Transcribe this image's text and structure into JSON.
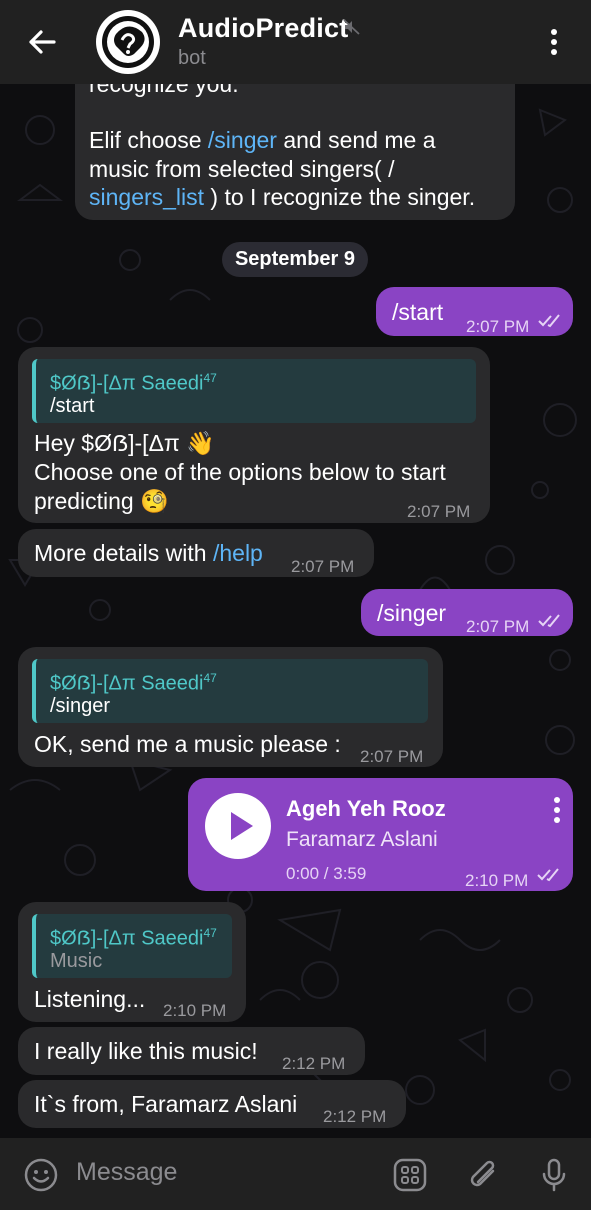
{
  "header": {
    "title": "AudioPredict",
    "subtitle": "bot"
  },
  "intro_bubble": {
    "top_fragment": "recognize you.",
    "line1a": "Elif choose ",
    "line1_link": "/singer",
    "line1b": " and send me a",
    "line2": "music from selected singers( /",
    "line3_link": "singers_list",
    "line3b": " ) to I recognize the singer."
  },
  "date_pill": "September 9",
  "messages": {
    "m1": {
      "text": "/start",
      "time": "2:07 PM"
    },
    "m2": {
      "reply_name": "$Øẞ]-[Δπ Saeedi",
      "reply_sup": "47",
      "reply_text": "/start",
      "line1": "Hey $Øẞ]-[Δπ 👋",
      "line2": "Choose one of the options below to start",
      "line3": "predicting 🧐",
      "time": "2:07 PM"
    },
    "m3": {
      "text": "More details with ",
      "link": "/help",
      "time": "2:07 PM"
    },
    "m4": {
      "text": "/singer",
      "time": "2:07 PM"
    },
    "m5": {
      "reply_name": "$Øẞ]-[Δπ Saeedi",
      "reply_sup": "47",
      "reply_text": "/singer",
      "text": "OK, send me a music please :",
      "time": "2:07 PM"
    },
    "m6": {
      "track_title": "Ageh Yeh Rooz",
      "artist": "Faramarz Aslani",
      "duration": "0:00 / 3:59",
      "time": "2:10 PM"
    },
    "m7": {
      "reply_name": "$Øẞ]-[Δπ Saeedi",
      "reply_sup": "47",
      "reply_text": "Music",
      "text": "Listening...",
      "time": "2:10 PM"
    },
    "m8": {
      "text": "I really like this music!",
      "time": "2:12 PM"
    },
    "m9": {
      "text": "It`s from, Faramarz Aslani",
      "time": "2:12 PM"
    }
  },
  "composer": {
    "placeholder": "Message"
  },
  "icons": {
    "back": "arrow-left-icon",
    "mute": "muted-speaker-icon",
    "menu": "kebab-menu-icon",
    "emoji": "emoji-icon",
    "bot_commands": "bot-commands-icon",
    "attach": "paperclip-icon",
    "mic": "microphone-icon",
    "play": "play-icon",
    "read": "double-check-icon"
  },
  "colors": {
    "header_bg": "#212121",
    "incoming_bubble": "#2a2a2c",
    "outgoing_bubble": "#8a44c4",
    "link": "#5eb5f7",
    "reply_accent": "#4fc8c8"
  }
}
